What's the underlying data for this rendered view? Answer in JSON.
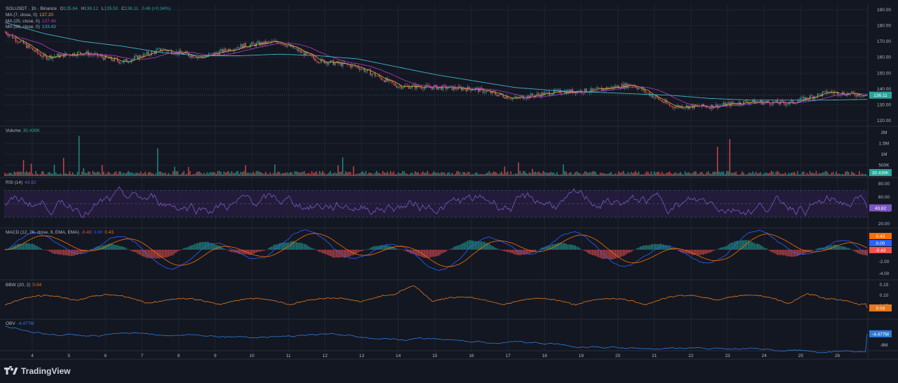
{
  "colors": {
    "bg": "#131722",
    "grid": "#1f2330",
    "axis": "#2a2e39",
    "text": "#b2b5be",
    "up": "#26a69a",
    "down": "#ef5350",
    "ma7": "#e4a93a",
    "ma25": "#b03cc8",
    "ma99": "#3fb4c8",
    "rsi": "#7e57c2",
    "rsi_band": "#2a1f44",
    "macd": "#2962ff",
    "signal": "#ff6d00",
    "bbw": "#e5781c",
    "obv": "#2e7bd6"
  },
  "header": {
    "symbol": "SOLUSDT · 1h · Binance",
    "o_label": "O",
    "o": "135.64",
    "h_label": "H",
    "h": "136.12",
    "l_label": "L",
    "l": "135.50",
    "c_label": "C",
    "c": "136.11",
    "change": "0.46 (+0.34%)"
  },
  "panes": {
    "ma7": {
      "label": "MA (7, close, 0)",
      "value": "137.20"
    },
    "ma25": {
      "label": "MA (25, close, 0)",
      "value": "137.49"
    },
    "ma99": {
      "label": "MA (99, close, 0)",
      "value": "133.43"
    },
    "volume": {
      "label": "Volume",
      "value": "30.439K"
    },
    "rsi": {
      "label": "RSI (14)",
      "value": "43.82"
    },
    "macd": {
      "label": "MACD (12, 26, close, 9, EMA, EMA)",
      "v1": "-0.43",
      "v2": "0.00",
      "v3": "0.43"
    },
    "bbw": {
      "label": "BBW (20, 2)",
      "value": "0.04"
    },
    "obv": {
      "label": "OBV",
      "value": "-4.477M"
    }
  },
  "axis_ticks": {
    "price": [
      "190.00",
      "180.00",
      "170.00",
      "160.00",
      "150.00",
      "140.00",
      "130.00",
      "120.00"
    ],
    "volume": [
      "2M",
      "1.5M",
      "1M",
      "500K"
    ],
    "rsi": [
      "80.00",
      "60.00",
      "40.00",
      "20.00"
    ],
    "macd": [
      "2.00",
      "-2.00",
      "-4.00"
    ],
    "bbw": [
      "0.15",
      "0.10",
      "0.05"
    ],
    "obv": [
      "-8M"
    ],
    "dates": [
      "4",
      "5",
      "6",
      "7",
      "8",
      "9",
      "10",
      "11",
      "12",
      "13",
      "14",
      "15",
      "16",
      "17",
      "18",
      "19",
      "20",
      "21",
      "22",
      "23",
      "24",
      "25",
      "26"
    ]
  },
  "price_tags": {
    "price": "136.11",
    "volume": "30.439K",
    "rsi": "43.82",
    "macd_top": "0.43",
    "macd_mid": "0.00",
    "macd_bot": "-0.43",
    "bbw": "0.04",
    "obv": "-4.477M"
  },
  "brand": "TradingView",
  "chart_data": {
    "type": "line",
    "title": "SOLUSDT · 1h · Binance",
    "x": [
      "4",
      "5",
      "6",
      "7",
      "8",
      "9",
      "10",
      "11",
      "12",
      "13",
      "14",
      "15",
      "16",
      "17",
      "18",
      "19",
      "20",
      "21",
      "22",
      "23",
      "24",
      "25",
      "26"
    ],
    "ylim": [
      120,
      190
    ],
    "series": [
      {
        "name": "Close",
        "values": [
          176,
          160,
          163,
          157,
          165,
          160,
          167,
          170,
          158,
          154,
          142,
          141,
          140,
          134,
          138,
          139,
          143,
          129,
          129,
          132,
          131,
          138,
          136.11
        ]
      },
      {
        "name": "MA (99, close, 0)",
        "values": [
          182,
          175,
          170,
          167,
          163,
          161,
          161,
          162,
          161,
          159,
          154,
          149,
          145,
          141,
          139,
          138,
          137,
          136,
          134,
          133,
          133,
          133,
          133.43
        ]
      }
    ],
    "volume": {
      "ylim": [
        0,
        2000000
      ],
      "last": 30439
    },
    "rsi": {
      "ylim": [
        20,
        80
      ],
      "bands": [
        30,
        70
      ],
      "last": 43.82
    },
    "macd": {
      "last": [
        -0.43,
        0.0,
        0.43
      ]
    },
    "bbw": {
      "ylim": [
        0,
        0.15
      ],
      "last": 0.04
    },
    "obv": {
      "last": -4477000
    }
  }
}
